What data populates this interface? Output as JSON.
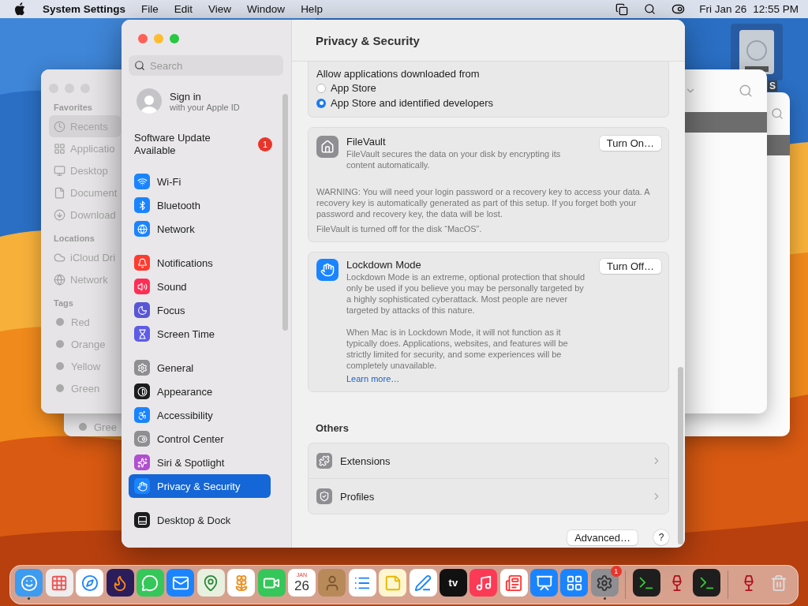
{
  "menu_bar": {
    "app_name": "System Settings",
    "menus": [
      "File",
      "Edit",
      "View",
      "Window",
      "Help"
    ],
    "date": "Fri Jan 26",
    "time": "12:55 PM"
  },
  "desktop": {
    "disk_label": "S"
  },
  "finder_front": {
    "sections": [
      {
        "heading": "Favorites",
        "items": [
          {
            "label": "Recents",
            "kind": "recents",
            "selected": true
          },
          {
            "label": "Applicatio",
            "kind": "applications",
            "selected": false
          },
          {
            "label": "Desktop",
            "kind": "desktop",
            "selected": false
          },
          {
            "label": "Document",
            "kind": "documents",
            "selected": false
          },
          {
            "label": "Download",
            "kind": "downloads",
            "selected": false
          }
        ]
      },
      {
        "heading": "Locations",
        "items": [
          {
            "label": "iCloud Dri",
            "kind": "icloud",
            "selected": false
          },
          {
            "label": "Network",
            "kind": "network",
            "selected": false
          }
        ]
      },
      {
        "heading": "Tags",
        "items": [
          {
            "label": "Red",
            "kind": "tag",
            "selected": false
          },
          {
            "label": "Orange",
            "kind": "tag",
            "selected": false
          },
          {
            "label": "Yellow",
            "kind": "tag",
            "selected": false
          },
          {
            "label": "Green",
            "kind": "tag",
            "selected": false
          }
        ]
      }
    ]
  },
  "finder_back": {
    "tag": "Gree"
  },
  "settings": {
    "sidebar": {
      "search_placeholder": "Search",
      "account": {
        "title": "Sign in",
        "subtitle": "with your Apple ID"
      },
      "update": {
        "label": "Software Update Available",
        "badge": "1"
      },
      "groups": [
        [
          {
            "label": "Wi-Fi",
            "kind": "wifi",
            "color": "#1a84ff",
            "selected": false
          },
          {
            "label": "Bluetooth",
            "kind": "bluetooth",
            "color": "#1a84ff",
            "selected": false
          },
          {
            "label": "Network",
            "kind": "network",
            "color": "#1a84ff",
            "selected": false
          }
        ],
        [
          {
            "label": "Notifications",
            "kind": "notifications",
            "color": "#ff3b30",
            "selected": false
          },
          {
            "label": "Sound",
            "kind": "sound",
            "color": "#ff2d55",
            "selected": false
          },
          {
            "label": "Focus",
            "kind": "focus",
            "color": "#5856d6",
            "selected": false
          },
          {
            "label": "Screen Time",
            "kind": "screentime",
            "color": "#5e5ce6",
            "selected": false
          }
        ],
        [
          {
            "label": "General",
            "kind": "general",
            "color": "#8e8e93",
            "selected": false
          },
          {
            "label": "Appearance",
            "kind": "appearance",
            "color": "#1c1c1e",
            "selected": false
          },
          {
            "label": "Accessibility",
            "kind": "accessibility",
            "color": "#1a84ff",
            "selected": false
          },
          {
            "label": "Control Center",
            "kind": "controlcenter",
            "color": "#8e8e93",
            "selected": false
          },
          {
            "label": "Siri & Spotlight",
            "kind": "siri",
            "color": "#b04fd0",
            "selected": false
          },
          {
            "label": "Privacy & Security",
            "kind": "privacy",
            "color": "#1a84ff",
            "selected": true
          }
        ],
        [
          {
            "label": "Desktop & Dock",
            "kind": "dock",
            "color": "#1c1c1e",
            "selected": false
          }
        ]
      ]
    },
    "content": {
      "title": "Privacy & Security",
      "allow": {
        "label": "Allow applications downloaded from",
        "options": [
          {
            "label": "App Store",
            "selected": false
          },
          {
            "label": "App Store and identified developers",
            "selected": true
          }
        ]
      },
      "filevault": {
        "title": "FileVault",
        "description": "FileVault secures the data on your disk by encrypting its content automatically.",
        "button": "Turn On…",
        "warning": "WARNING: You will need your login password or a recovery key to access your data. A recovery key is automatically generated as part of this setup. If you forget both your password and recovery key, the data will be lost.",
        "status": "FileVault is turned off for the disk “MacOS”."
      },
      "lockdown": {
        "title": "Lockdown Mode",
        "description": "Lockdown Mode is an extreme, optional protection that should only be used if you believe you may be personally targeted by a highly sophisticated cyberattack. Most people are never targeted by attacks of this nature.",
        "details": "When Mac is in Lockdown Mode, it will not function as it typically does. Applications, websites, and features will be strictly limited for security, and some experiences will be completely unavailable.",
        "link": "Learn more…",
        "button": "Turn Off…"
      },
      "others": {
        "heading": "Others",
        "rows": [
          {
            "label": "Extensions",
            "kind": "extensions"
          },
          {
            "label": "Profiles",
            "kind": "profiles"
          }
        ]
      },
      "advanced_button": "Advanced…",
      "help_button": "?"
    }
  },
  "dock": {
    "sections": [
      [
        {
          "kind": "finder",
          "running": true
        },
        {
          "kind": "launchpad",
          "running": false
        },
        {
          "kind": "safari",
          "running": false
        },
        {
          "kind": "firefox",
          "running": false
        },
        {
          "kind": "messages",
          "running": false
        },
        {
          "kind": "mail",
          "running": false
        },
        {
          "kind": "maps",
          "running": false
        },
        {
          "kind": "photos",
          "running": false
        },
        {
          "kind": "facetime",
          "running": false
        },
        {
          "kind": "calendar",
          "running": false,
          "month": "JAN",
          "day": "26"
        },
        {
          "kind": "contacts",
          "running": false
        },
        {
          "kind": "reminders",
          "running": false
        },
        {
          "kind": "notes",
          "running": false
        },
        {
          "kind": "freeform",
          "running": false
        },
        {
          "kind": "tv",
          "running": false,
          "text": "tv"
        },
        {
          "kind": "music",
          "running": false
        },
        {
          "kind": "news",
          "running": false
        },
        {
          "kind": "keynote",
          "running": false
        },
        {
          "kind": "appstore",
          "running": false
        },
        {
          "kind": "settings",
          "running": true,
          "badge": "1"
        }
      ],
      [
        {
          "kind": "terminal",
          "running": false
        },
        {
          "kind": "wine",
          "running": false
        },
        {
          "kind": "terminal",
          "running": false
        }
      ],
      [
        {
          "kind": "wine",
          "running": false
        },
        {
          "kind": "trash",
          "running": false
        }
      ]
    ]
  }
}
